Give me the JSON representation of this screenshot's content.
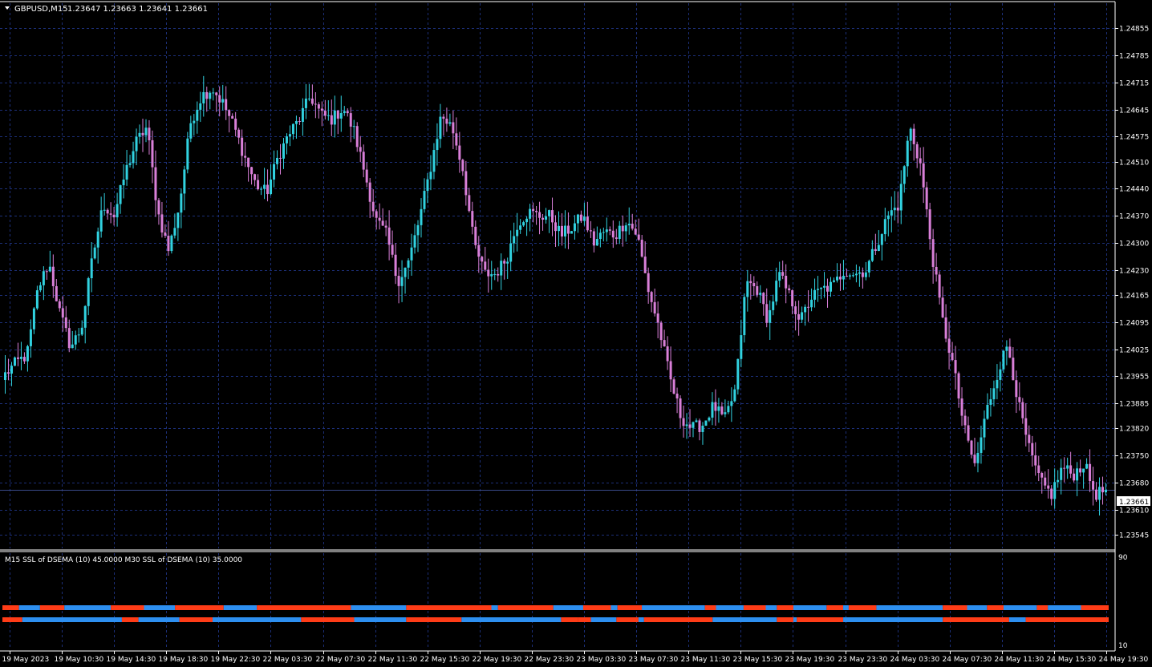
{
  "chart_data": {
    "type": "candlestick",
    "symbol_label": "GBPUSD,M15",
    "ohlc_label": "1.23647 1.23663 1.23641 1.23661",
    "current_price": 1.23661,
    "current_price_label": "1.23661",
    "ylim": [
      1.2351,
      1.2492
    ],
    "y_ticks": [
      "1.24855",
      "1.24785",
      "1.24715",
      "1.24645",
      "1.24575",
      "1.24510",
      "1.24440",
      "1.24370",
      "1.24300",
      "1.24230",
      "1.24165",
      "1.24095",
      "1.24025",
      "1.23955",
      "1.23885",
      "1.23820",
      "1.23750",
      "1.23680",
      "1.23610",
      "1.23545"
    ],
    "x_ticks": [
      "19 May 2023",
      "19 May 10:30",
      "19 May 14:30",
      "19 May 18:30",
      "19 May 22:30",
      "22 May 03:30",
      "22 May 07:30",
      "22 May 11:30",
      "22 May 15:30",
      "22 May 19:30",
      "22 May 23:30",
      "23 May 03:30",
      "23 May 07:30",
      "23 May 11:30",
      "23 May 15:30",
      "23 May 19:30",
      "23 May 23:30",
      "24 May 03:30",
      "24 May 07:30",
      "24 May 11:30",
      "24 May 15:30",
      "24 May 19:30"
    ],
    "close_path": [
      1.2396,
      1.2399,
      1.2401,
      1.2418,
      1.2425,
      1.2412,
      1.2403,
      1.2408,
      1.2426,
      1.244,
      1.2437,
      1.2448,
      1.2456,
      1.246,
      1.2438,
      1.2428,
      1.244,
      1.2461,
      1.2468,
      1.247,
      1.2466,
      1.246,
      1.2452,
      1.2445,
      1.2443,
      1.2452,
      1.2458,
      1.2462,
      1.2468,
      1.2463,
      1.2462,
      1.2465,
      1.2459,
      1.2448,
      1.2436,
      1.2432,
      1.242,
      1.2425,
      1.2436,
      1.2449,
      1.2463,
      1.246,
      1.2449,
      1.243,
      1.2422,
      1.2422,
      1.2426,
      1.2435,
      1.2438,
      1.2437,
      1.2437,
      1.2432,
      1.2434,
      1.2437,
      1.243,
      1.2433,
      1.2432,
      1.2436,
      1.2432,
      1.2418,
      1.2408,
      1.2395,
      1.2385,
      1.2382,
      1.2383,
      1.2388,
      1.2384,
      1.2392,
      1.242,
      1.2418,
      1.241,
      1.2422,
      1.2416,
      1.241,
      1.2416,
      1.2418,
      1.2419,
      1.2423,
      1.2422,
      1.2423,
      1.243,
      1.2437,
      1.244,
      1.246,
      1.245,
      1.2428,
      1.241,
      1.2398,
      1.2382,
      1.2372,
      1.2386,
      1.2396,
      1.2404,
      1.2388,
      1.2376,
      1.2368,
      1.2365,
      1.2372,
      1.237,
      1.2373,
      1.2365,
      1.2366
    ],
    "colors": {
      "bull": "#31d2e0",
      "bear": "#d97fd8",
      "grid": "#1c2f78",
      "text": "#ffffff",
      "ind_blue": "#2d8ff0",
      "ind_red": "#ff3c17"
    },
    "indicator": {
      "label": "M15 SSL of DSEMA (10) 45.0000  M30 SSL of DSEMA (10) 35.0000",
      "y_max_label": "90",
      "y_min_label": "10",
      "row1": [
        [
          "r",
          0.0
        ],
        [
          "b",
          0.015
        ],
        [
          "r",
          0.034
        ],
        [
          "b",
          0.056
        ],
        [
          "r",
          0.098
        ],
        [
          "b",
          0.128
        ],
        [
          "r",
          0.156
        ],
        [
          "b",
          0.2
        ],
        [
          "r",
          0.23
        ],
        [
          "b",
          0.315
        ],
        [
          "r",
          0.365
        ],
        [
          "b",
          0.442
        ],
        [
          "r",
          0.448
        ],
        [
          "b",
          0.498
        ],
        [
          "r",
          0.525
        ],
        [
          "b",
          0.55
        ],
        [
          "r",
          0.556
        ],
        [
          "b",
          0.578
        ],
        [
          "r",
          0.635
        ],
        [
          "b",
          0.645
        ],
        [
          "r",
          0.67
        ],
        [
          "b",
          0.69
        ],
        [
          "r",
          0.7
        ],
        [
          "b",
          0.715
        ],
        [
          "r",
          0.745
        ],
        [
          "b",
          0.76
        ],
        [
          "r",
          0.765
        ],
        [
          "b",
          0.79
        ],
        [
          "r",
          0.85
        ],
        [
          "b",
          0.872
        ],
        [
          "r",
          0.89
        ],
        [
          "b",
          0.905
        ],
        [
          "r",
          0.935
        ],
        [
          "b",
          0.945
        ],
        [
          "r",
          0.975
        ],
        [
          "b",
          1.0
        ]
      ],
      "row2": [
        [
          "r",
          0.0
        ],
        [
          "b",
          0.018
        ],
        [
          "r",
          0.108
        ],
        [
          "b",
          0.123
        ],
        [
          "r",
          0.16
        ],
        [
          "b",
          0.19
        ],
        [
          "r",
          0.27
        ],
        [
          "b",
          0.318
        ],
        [
          "r",
          0.365
        ],
        [
          "b",
          0.415
        ],
        [
          "r",
          0.505
        ],
        [
          "r",
          0.52
        ],
        [
          "b",
          0.532
        ],
        [
          "r",
          0.555
        ],
        [
          "b",
          0.575
        ],
        [
          "r",
          0.58
        ],
        [
          "b",
          0.642
        ],
        [
          "r",
          0.7
        ],
        [
          "b",
          0.715
        ],
        [
          "r",
          0.718
        ],
        [
          "b",
          0.76
        ],
        [
          "r",
          0.85
        ],
        [
          "b",
          0.91
        ],
        [
          "r",
          0.925
        ],
        [
          "b",
          1.0
        ]
      ]
    }
  }
}
